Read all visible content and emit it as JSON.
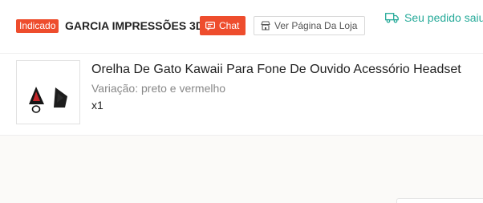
{
  "shop": {
    "badge": "Indicado",
    "name": "GARCIA IMPRESSÕES 3D",
    "chat_label": "Chat",
    "view_store_label": "Ver Página Da Loja"
  },
  "order_status": {
    "text": "Seu pedido saiu",
    "icon": "truck-icon",
    "color": "#26aa99"
  },
  "item": {
    "title": "Orelha De Gato Kawaii Para Fone De Ouvido Acessório Headset",
    "variation": "Variação: preto e vermelho",
    "quantity": "x1"
  },
  "colors": {
    "accent": "#ee4d2d",
    "status": "#26aa99"
  }
}
